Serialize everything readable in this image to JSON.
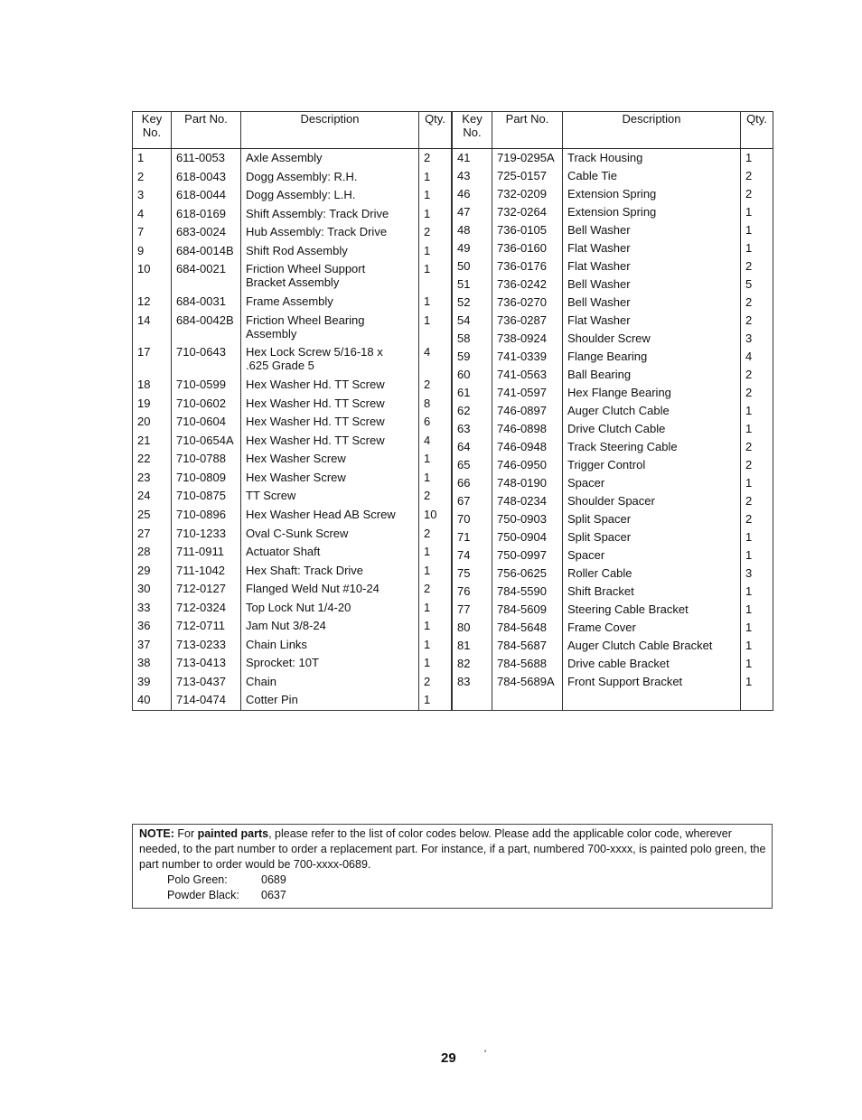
{
  "headers": {
    "key_no": "Key No.",
    "part_no": "Part No.",
    "description": "Description",
    "qty": "Qty."
  },
  "left_table": [
    {
      "key": "1",
      "part": "611-0053",
      "desc": "Axle Assembly",
      "qty": "2"
    },
    {
      "key": "2",
      "part": "618-0043",
      "desc": "Dogg Assembly: R.H.",
      "qty": "1"
    },
    {
      "key": "3",
      "part": "618-0044",
      "desc": "Dogg Assembly: L.H.",
      "qty": "1"
    },
    {
      "key": "4",
      "part": "618-0169",
      "desc": "Shift Assembly: Track Drive",
      "qty": "1"
    },
    {
      "key": "7",
      "part": "683-0024",
      "desc": "Hub Assembly: Track Drive",
      "qty": "2"
    },
    {
      "key": "9",
      "part": "684-0014B",
      "desc": "Shift Rod Assembly",
      "qty": "1"
    },
    {
      "key": "10",
      "part": "684-0021",
      "desc": "Friction Wheel Support\nBracket Assembly",
      "qty": "1"
    },
    {
      "key": "12",
      "part": "684-0031",
      "desc": "Frame Assembly",
      "qty": "1"
    },
    {
      "key": "14",
      "part": "684-0042B",
      "desc": "Friction Wheel Bearing\nAssembly",
      "qty": "1"
    },
    {
      "key": "17",
      "part": "710-0643",
      "desc": "Hex Lock Screw 5/16-18 x\n.625 Grade 5",
      "qty": "4"
    },
    {
      "key": "18",
      "part": "710-0599",
      "desc": "Hex Washer Hd. TT Screw",
      "qty": "2"
    },
    {
      "key": "19",
      "part": "710-0602",
      "desc": "Hex Washer Hd. TT Screw",
      "qty": "8"
    },
    {
      "key": "20",
      "part": "710-0604",
      "desc": "Hex Washer Hd. TT Screw",
      "qty": "6"
    },
    {
      "key": "21",
      "part": "710-0654A",
      "desc": "Hex Washer Hd. TT Screw",
      "qty": "4"
    },
    {
      "key": "22",
      "part": "710-0788",
      "desc": "Hex Washer Screw",
      "qty": "1"
    },
    {
      "key": "23",
      "part": "710-0809",
      "desc": "Hex Washer Screw",
      "qty": "1"
    },
    {
      "key": "24",
      "part": "710-0875",
      "desc": "TT Screw",
      "qty": "2"
    },
    {
      "key": "25",
      "part": "710-0896",
      "desc": "Hex Washer Head AB Screw",
      "qty": "10"
    },
    {
      "key": "27",
      "part": "710-1233",
      "desc": "Oval C-Sunk Screw",
      "qty": "2"
    },
    {
      "key": "28",
      "part": "711-0911",
      "desc": "Actuator Shaft",
      "qty": "1"
    },
    {
      "key": "29",
      "part": "711-1042",
      "desc": "Hex Shaft: Track Drive",
      "qty": "1"
    },
    {
      "key": "30",
      "part": "712-0127",
      "desc": "Flanged Weld Nut #10-24",
      "qty": "2"
    },
    {
      "key": "33",
      "part": "712-0324",
      "desc": "Top Lock Nut 1/4-20",
      "qty": "1"
    },
    {
      "key": "36",
      "part": "712-0711",
      "desc": "Jam Nut 3/8-24",
      "qty": "1"
    },
    {
      "key": "37",
      "part": "713-0233",
      "desc": "Chain Links",
      "qty": "1"
    },
    {
      "key": "38",
      "part": "713-0413",
      "desc": "Sprocket: 10T",
      "qty": "1"
    },
    {
      "key": "39",
      "part": "713-0437",
      "desc": "Chain",
      "qty": "2"
    },
    {
      "key": "40",
      "part": "714-0474",
      "desc": "Cotter Pin",
      "qty": "1"
    }
  ],
  "right_table": [
    {
      "key": "41",
      "part": "719-0295A",
      "desc": "Track Housing",
      "qty": "1"
    },
    {
      "key": "43",
      "part": "725-0157",
      "desc": "Cable Tie",
      "qty": "2"
    },
    {
      "key": "46",
      "part": "732-0209",
      "desc": "Extension Spring",
      "qty": "2"
    },
    {
      "key": "47",
      "part": "732-0264",
      "desc": "Extension Spring",
      "qty": "1"
    },
    {
      "key": "48",
      "part": "736-0105",
      "desc": "Bell Washer",
      "qty": "1"
    },
    {
      "key": "49",
      "part": "736-0160",
      "desc": "Flat Washer",
      "qty": "1"
    },
    {
      "key": "50",
      "part": "736-0176",
      "desc": "Flat Washer",
      "qty": "2"
    },
    {
      "key": "51",
      "part": "736-0242",
      "desc": "Bell Washer",
      "qty": "5"
    },
    {
      "key": "52",
      "part": "736-0270",
      "desc": "Bell Washer",
      "qty": "2"
    },
    {
      "key": "54",
      "part": "736-0287",
      "desc": "Flat Washer",
      "qty": "2"
    },
    {
      "key": "58",
      "part": "738-0924",
      "desc": "Shoulder Screw",
      "qty": "3"
    },
    {
      "key": "59",
      "part": "741-0339",
      "desc": "Flange Bearing",
      "qty": "4"
    },
    {
      "key": "60",
      "part": "741-0563",
      "desc": "Ball Bearing",
      "qty": "2"
    },
    {
      "key": "61",
      "part": "741-0597",
      "desc": "Hex Flange Bearing",
      "qty": "2"
    },
    {
      "key": "62",
      "part": "746-0897",
      "desc": "Auger Clutch Cable",
      "qty": "1"
    },
    {
      "key": "63",
      "part": "746-0898",
      "desc": "Drive Clutch Cable",
      "qty": "1"
    },
    {
      "key": "64",
      "part": "746-0948",
      "desc": "Track Steering Cable",
      "qty": "2"
    },
    {
      "key": "65",
      "part": "746-0950",
      "desc": "Trigger Control",
      "qty": "2"
    },
    {
      "key": "66",
      "part": "748-0190",
      "desc": "Spacer",
      "qty": "1"
    },
    {
      "key": "67",
      "part": "748-0234",
      "desc": "Shoulder Spacer",
      "qty": "2"
    },
    {
      "key": "70",
      "part": "750-0903",
      "desc": "Split Spacer",
      "qty": "2"
    },
    {
      "key": "71",
      "part": "750-0904",
      "desc": "Split Spacer",
      "qty": "1"
    },
    {
      "key": "74",
      "part": "750-0997",
      "desc": "Spacer",
      "qty": "1"
    },
    {
      "key": "75",
      "part": "756-0625",
      "desc": "Roller Cable",
      "qty": "3"
    },
    {
      "key": "76",
      "part": "784-5590",
      "desc": "Shift Bracket",
      "qty": "1"
    },
    {
      "key": "77",
      "part": "784-5609",
      "desc": "Steering Cable Bracket",
      "qty": "1"
    },
    {
      "key": "80",
      "part": "784-5648",
      "desc": "Frame Cover",
      "qty": "1"
    },
    {
      "key": "81",
      "part": "784-5687",
      "desc": "Auger Clutch Cable Bracket",
      "qty": "1"
    },
    {
      "key": "82",
      "part": "784-5688",
      "desc": "Drive cable Bracket",
      "qty": "1"
    },
    {
      "key": "83",
      "part": "784-5689A",
      "desc": "Front Support Bracket",
      "qty": "1"
    }
  ],
  "note": {
    "label": "NOTE:",
    "intro": " For ",
    "emphasis": "painted parts",
    "body": ", please refer to the list of color codes below. Please add the applicable color code, wherever needed, to the part number to order a replacement part. For instance, if a part, numbered 700-xxxx, is painted polo green, the part number to order would be 700-xxxx-0689.",
    "colors": [
      {
        "name": "Polo Green:",
        "code": "0689"
      },
      {
        "name": "Powder Black:",
        "code": "0637"
      }
    ]
  },
  "page_number": "29",
  "stray_mark": "'"
}
